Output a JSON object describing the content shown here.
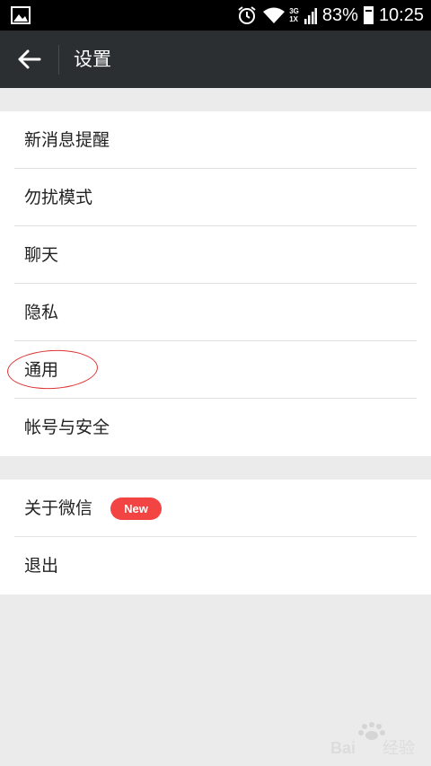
{
  "status_bar": {
    "network_top": "3G",
    "network_bottom": "1X",
    "battery": "83%",
    "battery_level": 0.83,
    "time": "10:25",
    "icons": [
      "image-icon",
      "alarm-icon",
      "wifi-icon",
      "signal-icon",
      "battery-icon"
    ]
  },
  "header": {
    "title": "设置",
    "back_icon": "arrow-left-icon"
  },
  "settings_group_1": [
    {
      "label": "新消息提醒"
    },
    {
      "label": "勿扰模式"
    },
    {
      "label": "聊天"
    },
    {
      "label": "隐私"
    },
    {
      "label": "通用"
    },
    {
      "label": "帐号与安全"
    }
  ],
  "settings_group_2": [
    {
      "label": "关于微信",
      "badge": "New"
    },
    {
      "label": "退出"
    }
  ],
  "colors": {
    "title_bar": "#2b2f31",
    "badge": "#f34444",
    "annotation": "#dd3333",
    "background": "#ebebeb"
  },
  "watermark": {
    "text": "Bai 经验"
  }
}
